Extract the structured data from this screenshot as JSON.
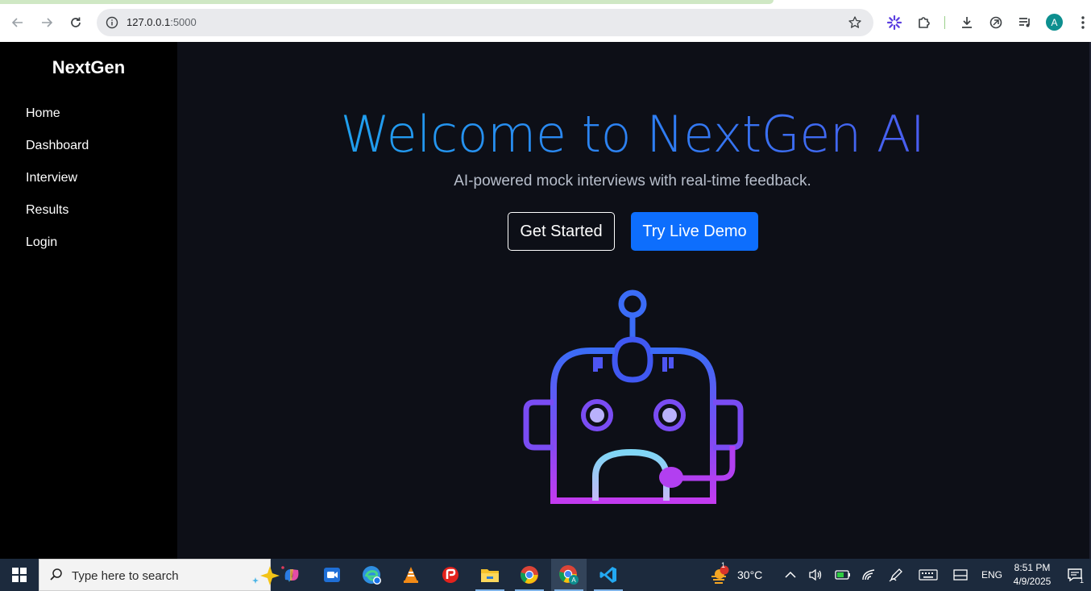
{
  "browser": {
    "url_host": "127.0.0.1",
    "url_port": ":5000",
    "profile_initial": "A",
    "icons": [
      "back-arrow-icon",
      "forward-arrow-icon",
      "reload-icon",
      "site-info-icon",
      "bookmark-star-icon",
      "extension-asterisk-icon",
      "extensions-puzzle-icon",
      "download-icon",
      "copilot-icon",
      "media-queue-icon",
      "kebab-menu-icon"
    ]
  },
  "sidebar": {
    "brand": "NextGen",
    "items": [
      {
        "label": "Home"
      },
      {
        "label": "Dashboard"
      },
      {
        "label": "Interview"
      },
      {
        "label": "Results"
      },
      {
        "label": "Login"
      }
    ]
  },
  "hero": {
    "title": "Welcome to NextGen AI",
    "subtitle": "AI-powered mock interviews with real-time feedback.",
    "primary_cta": "Get Started",
    "secondary_cta": "Try Live Demo",
    "illustration": "robot-headset-icon"
  },
  "taskbar": {
    "search_placeholder": "Type here to search",
    "weather_badge": "1",
    "temperature": "30°C",
    "language": "ENG",
    "time": "8:51 PM",
    "date": "4/9/2025",
    "notification_count": "1",
    "apps": [
      "copilot",
      "zoom",
      "edge",
      "vlc",
      "pdf-reader",
      "file-explorer",
      "chrome",
      "chrome-profile",
      "vscode"
    ]
  },
  "colors": {
    "sidebar_bg": "#000000",
    "main_bg": "#0d0f17",
    "primary": "#0d6efd",
    "title_gradient_start": "#1fa0ee",
    "title_gradient_end": "#4a5cf0",
    "robot_gradient_top": "#3b6cf6",
    "robot_gradient_bottom": "#c23bf0"
  }
}
